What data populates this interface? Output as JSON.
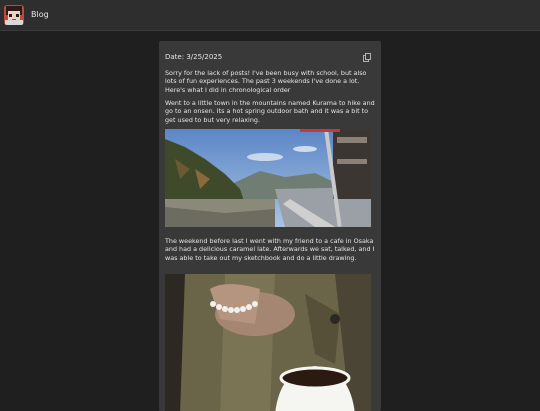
{
  "header": {
    "site_name": "Blog",
    "logo_icon": "avatar-logo-icon"
  },
  "post": {
    "date": "Date: 3/25/2025",
    "copy_icon": "copy-icon",
    "paragraphs": [
      "Sorry for the lack of posts! I've been busy with school, but also lots of fun experiences. The past 3 weekends I've done a lot. Here's what I did in chronological order",
      "Went to a little town in the mountains named Kurama to hike and go to an onsen. Its a hot spring outdoor bath and it was a bit to get used to but very relaxing.",
      "The weekend before last I went with my friend to a cafe in Osaka and had a delicious caramel late. Afterwards we sat, talked, and I was able to take out my sketchbook and do a little drawing."
    ]
  },
  "colors": {
    "page_bg": "#1f1f20",
    "header_bg": "#2e2e2f",
    "card_bg": "#39393a",
    "text": "#e6e6e6"
  }
}
